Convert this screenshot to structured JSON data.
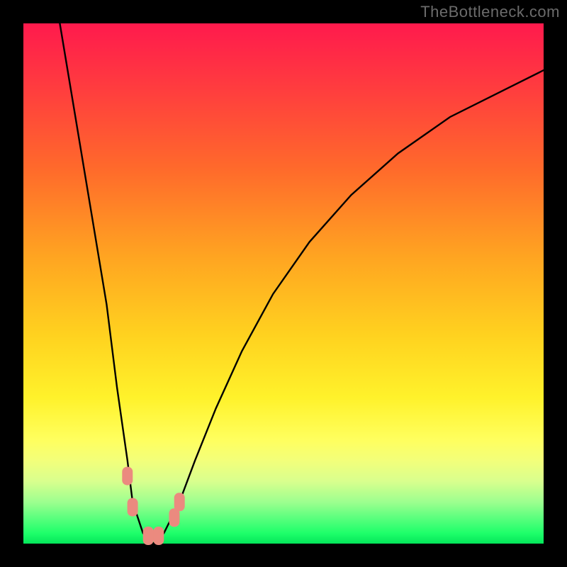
{
  "watermark": "TheBottleneck.com",
  "colors": {
    "frame": "#000000",
    "gradient_top": "#ff1a4d",
    "gradient_bottom": "#04e65a",
    "curve": "#000000",
    "marker": "#eb8a7f"
  },
  "chart_data": {
    "type": "line",
    "title": "",
    "xlabel": "",
    "ylabel": "",
    "xlim": [
      0,
      100
    ],
    "ylim": [
      0,
      100
    ],
    "grid": false,
    "legend": false,
    "note": "Axes have no visible tick labels; values are normalized 0–100. Curve is a V-shape reaching y≈0 at the trough.",
    "series": [
      {
        "name": "bottleneck-curve",
        "x": [
          7,
          10,
          13,
          16,
          18,
          20,
          21,
          23,
          25,
          27,
          30,
          33,
          37,
          42,
          48,
          55,
          63,
          72,
          82,
          92,
          100
        ],
        "y": [
          100,
          82,
          64,
          46,
          30,
          16,
          8,
          2,
          0,
          2,
          8,
          16,
          26,
          37,
          48,
          58,
          67,
          75,
          82,
          87,
          91
        ]
      }
    ],
    "markers": [
      {
        "name": "pt-a",
        "x": 20,
        "y": 13
      },
      {
        "name": "pt-b",
        "x": 21,
        "y": 7
      },
      {
        "name": "pt-c",
        "x": 24,
        "y": 1.5
      },
      {
        "name": "pt-d",
        "x": 26,
        "y": 1.5
      },
      {
        "name": "pt-e",
        "x": 29,
        "y": 5
      },
      {
        "name": "pt-f",
        "x": 30,
        "y": 8
      }
    ]
  }
}
